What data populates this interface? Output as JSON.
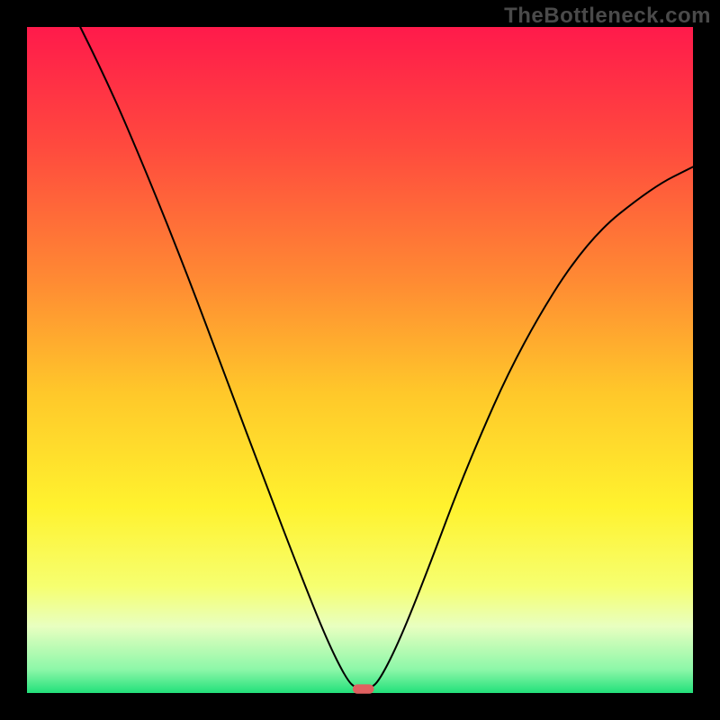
{
  "watermark_text": "TheBottleneck.com",
  "chart_data": {
    "type": "line",
    "title": "",
    "xlabel": "",
    "ylabel": "",
    "xlim": [
      0,
      100
    ],
    "ylim": [
      0,
      100
    ],
    "axes_visible": false,
    "background": {
      "type": "vertical_gradient",
      "stops": [
        {
          "offset": 0.0,
          "color": "#ff1a4b"
        },
        {
          "offset": 0.18,
          "color": "#ff4a3e"
        },
        {
          "offset": 0.38,
          "color": "#ff8a33"
        },
        {
          "offset": 0.55,
          "color": "#ffc82a"
        },
        {
          "offset": 0.72,
          "color": "#fff22e"
        },
        {
          "offset": 0.84,
          "color": "#f6ff70"
        },
        {
          "offset": 0.9,
          "color": "#e8ffc0"
        },
        {
          "offset": 0.965,
          "color": "#8cf7a8"
        },
        {
          "offset": 1.0,
          "color": "#22e07a"
        }
      ]
    },
    "series": [
      {
        "name": "bottleneck-curve",
        "stroke": "#000000",
        "stroke_width": 2,
        "points": [
          {
            "x": 8.0,
            "y": 100.0
          },
          {
            "x": 12.0,
            "y": 92.0
          },
          {
            "x": 18.0,
            "y": 78.0
          },
          {
            "x": 24.0,
            "y": 63.0
          },
          {
            "x": 30.0,
            "y": 47.0
          },
          {
            "x": 36.0,
            "y": 31.0
          },
          {
            "x": 41.0,
            "y": 18.0
          },
          {
            "x": 45.0,
            "y": 8.0
          },
          {
            "x": 48.0,
            "y": 2.0
          },
          {
            "x": 49.5,
            "y": 0.6
          },
          {
            "x": 51.5,
            "y": 0.6
          },
          {
            "x": 53.0,
            "y": 2.0
          },
          {
            "x": 56.0,
            "y": 8.0
          },
          {
            "x": 60.0,
            "y": 18.0
          },
          {
            "x": 66.0,
            "y": 34.0
          },
          {
            "x": 74.0,
            "y": 52.0
          },
          {
            "x": 84.0,
            "y": 68.0
          },
          {
            "x": 94.0,
            "y": 76.0
          },
          {
            "x": 100.0,
            "y": 79.0
          }
        ]
      }
    ],
    "marker": {
      "name": "optimal-point",
      "shape": "capsule",
      "x": 50.5,
      "y": 0.6,
      "width": 3.2,
      "height": 1.4,
      "fill": "#e06060"
    }
  },
  "plot_geometry": {
    "outer_w": 800,
    "outer_h": 800,
    "inner_x": 30,
    "inner_y": 30,
    "inner_w": 740,
    "inner_h": 740
  }
}
